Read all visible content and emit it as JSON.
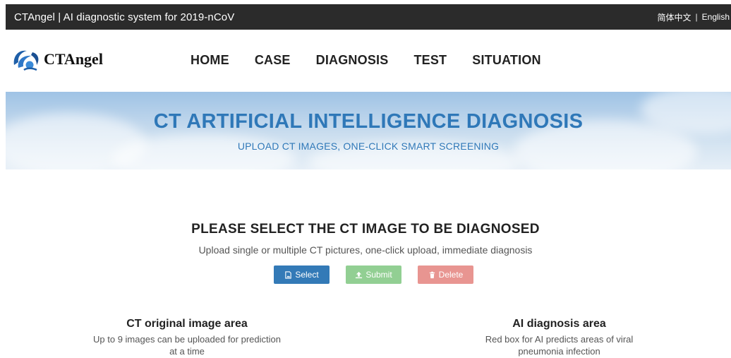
{
  "topbar": {
    "title": "CTAngel  |  AI diagnostic system for 2019-nCoV",
    "lang_cn": "简体中文",
    "lang_sep": "|",
    "lang_en": "English"
  },
  "brand": {
    "name": "CTAngel"
  },
  "nav": {
    "items": [
      {
        "label": "HOME"
      },
      {
        "label": "CASE"
      },
      {
        "label": "DIAGNOSIS"
      },
      {
        "label": "TEST"
      },
      {
        "label": "SITUATION"
      }
    ]
  },
  "banner": {
    "title": "CT ARTIFICIAL INTELLIGENCE DIAGNOSIS",
    "subtitle": "UPLOAD CT IMAGES, ONE-CLICK SMART SCREENING"
  },
  "upload": {
    "title": "PLEASE SELECT THE CT IMAGE TO BE DIAGNOSED",
    "description": "Upload single or multiple CT pictures, one-click upload, immediate diagnosis",
    "buttons": {
      "select": {
        "label": "Select",
        "icon": "image-file-icon",
        "color": "#337ab7"
      },
      "submit": {
        "label": "Submit",
        "icon": "upload-icon",
        "color": "#92cf93"
      },
      "delete": {
        "label": "Delete",
        "icon": "trash-icon",
        "color": "#e89591"
      }
    }
  },
  "areas": {
    "original": {
      "title": "CT original image area",
      "line1": "Up to 9 images can be uploaded for prediction",
      "line2": "at a time"
    },
    "diagnosis": {
      "title": "AI diagnosis area",
      "line1": "Red box for AI predicts areas of viral",
      "line2": "pneumonia infection"
    }
  },
  "colors": {
    "topbar_bg": "#2b2b2b",
    "banner_text": "#2f78b8"
  }
}
